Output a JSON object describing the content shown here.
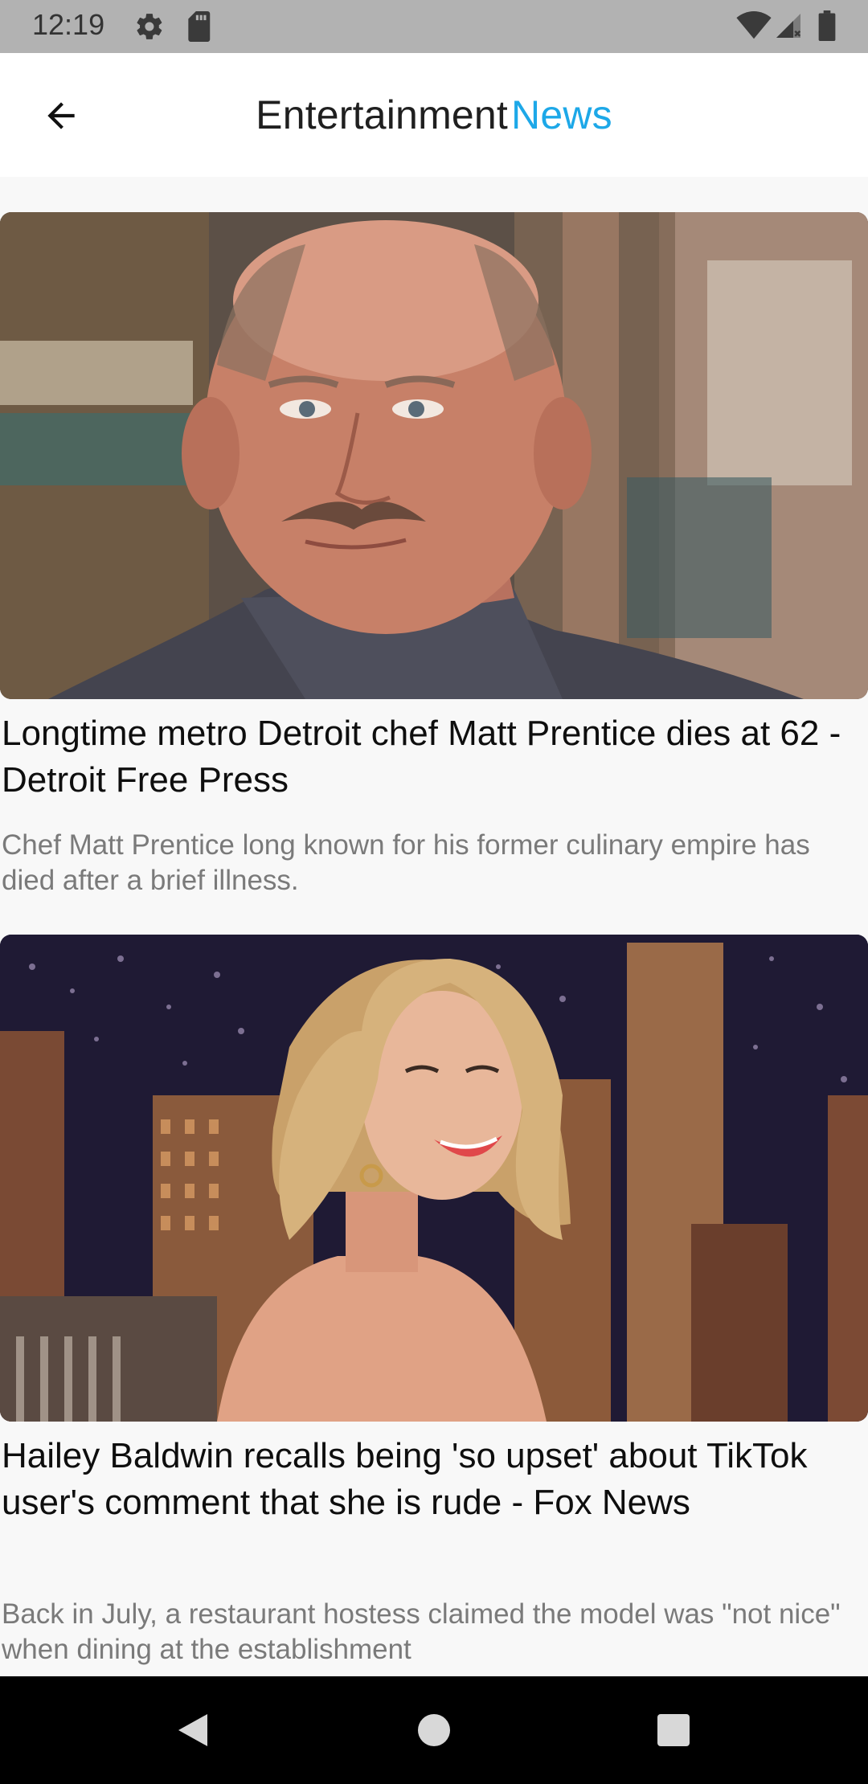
{
  "status_bar": {
    "time": "12:19",
    "icons": [
      "gear-icon",
      "sd-card-icon",
      "wifi-icon",
      "signal-icon",
      "battery-icon"
    ]
  },
  "app_bar": {
    "title_part_1": "Entertainment",
    "title_part_2": "News",
    "accent_color": "#1da8e8",
    "back_icon": "arrow-left-icon"
  },
  "articles": [
    {
      "title": "Longtime metro Detroit chef Matt Prentice dies at 62 - Detroit Free Press",
      "description": "Chef Matt Prentice long known for his former culinary empire has died after a brief illness."
    },
    {
      "title": "Hailey Baldwin recalls being 'so upset' about TikTok user's comment that she is rude - Fox News",
      "description": "Back in July, a restaurant hostess claimed the model was \"not nice\" when dining at the establishment"
    }
  ],
  "nav_bar": {
    "icons": [
      "back-triangle-icon",
      "home-circle-icon",
      "recents-square-icon"
    ]
  }
}
